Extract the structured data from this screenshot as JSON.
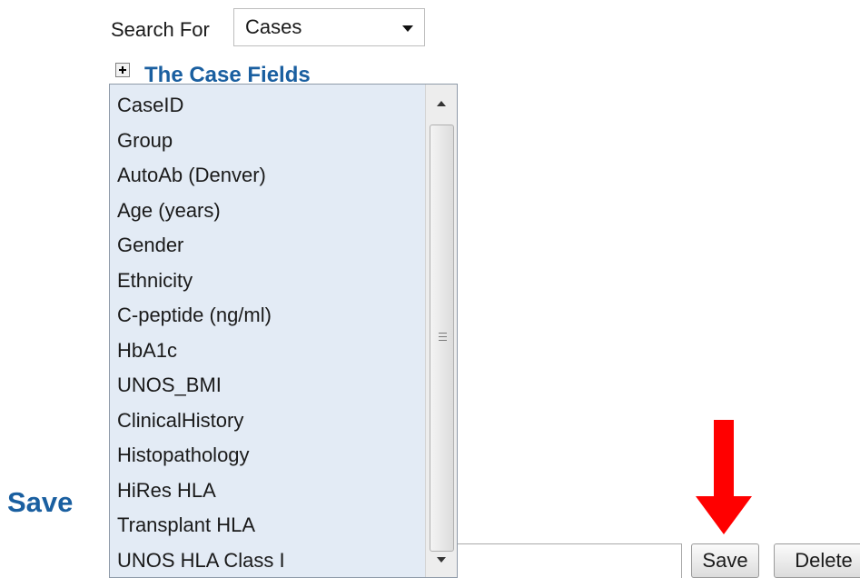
{
  "search": {
    "label": "Search For",
    "selected": "Cases"
  },
  "section": {
    "title": "The Case Fields",
    "icon": "plus-box-icon"
  },
  "field_list": {
    "items": [
      "CaseID",
      "Group",
      "AutoAb (Denver)",
      "Age (years)",
      "Gender",
      "Ethnicity",
      "C-peptide (ng/ml)",
      "HbA1c",
      "UNOS_BMI",
      "ClinicalHistory",
      "Histopathology",
      "HiRes HLA",
      "Transplant HLA",
      "UNOS HLA Class I"
    ]
  },
  "save_section": {
    "heading": "Save",
    "name_value": "",
    "save_label": "Save",
    "delete_label": "Delete"
  },
  "annotation": {
    "arrow_color": "#ff0000",
    "icon": "down-arrow-icon"
  },
  "colors": {
    "link_blue": "#1a5fa0",
    "list_background": "#e3ebf5"
  }
}
